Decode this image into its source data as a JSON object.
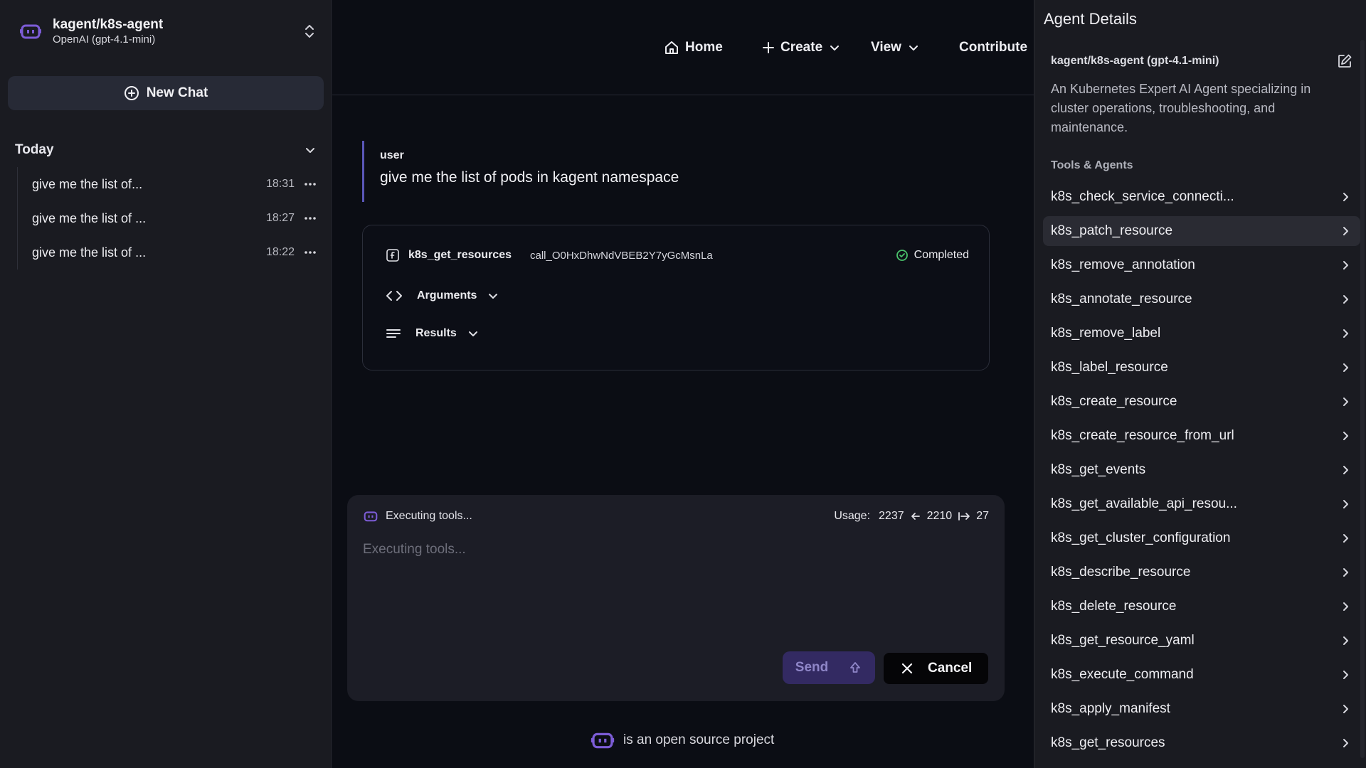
{
  "sidebar": {
    "agent_name": "kagent/k8s-agent",
    "agent_model": "OpenAI (gpt-4.1-mini)",
    "new_chat_label": "New Chat",
    "section_label": "Today",
    "history": [
      {
        "title": "give me the list of...",
        "time": "18:31"
      },
      {
        "title": "give me the list of ...",
        "time": "18:27"
      },
      {
        "title": "give me the list of ...",
        "time": "18:22"
      }
    ]
  },
  "nav": {
    "home": "Home",
    "create": "Create",
    "view": "View",
    "contribute": "Contribute"
  },
  "chat": {
    "user_role": "user",
    "user_message": "give me the list of pods in kagent namespace",
    "tool_call": {
      "name": "k8s_get_resources",
      "call_id": "call_O0HxDhwNdVBEB2Y7yGcMsnLa",
      "status": "Completed",
      "arguments_label": "Arguments",
      "results_label": "Results"
    }
  },
  "composer": {
    "status": "Executing tools...",
    "usage_label": "Usage:",
    "usage_total": "2237",
    "usage_prompt": "2210",
    "usage_completion": "27",
    "placeholder": "Executing tools...",
    "send_label": "Send",
    "cancel_label": "Cancel"
  },
  "footer": {
    "text": "is an open source project"
  },
  "details": {
    "title": "Agent Details",
    "agent": "kagent/k8s-agent (gpt-4.1-mini)",
    "description": "An Kubernetes Expert AI Agent specializing in cluster operations, troubleshooting, and maintenance.",
    "section": "Tools & Agents",
    "tools": [
      "k8s_check_service_connecti...",
      "k8s_patch_resource",
      "k8s_remove_annotation",
      "k8s_annotate_resource",
      "k8s_remove_label",
      "k8s_label_resource",
      "k8s_create_resource",
      "k8s_create_resource_from_url",
      "k8s_get_events",
      "k8s_get_available_api_resou...",
      "k8s_get_cluster_configuration",
      "k8s_describe_resource",
      "k8s_delete_resource",
      "k8s_get_resource_yaml",
      "k8s_execute_command",
      "k8s_apply_manifest",
      "k8s_get_resources"
    ]
  },
  "colors": {
    "background": "#0b0d14",
    "panel": "#1a1b21",
    "accent": "#7c5cd6",
    "success": "#4ac26b"
  }
}
